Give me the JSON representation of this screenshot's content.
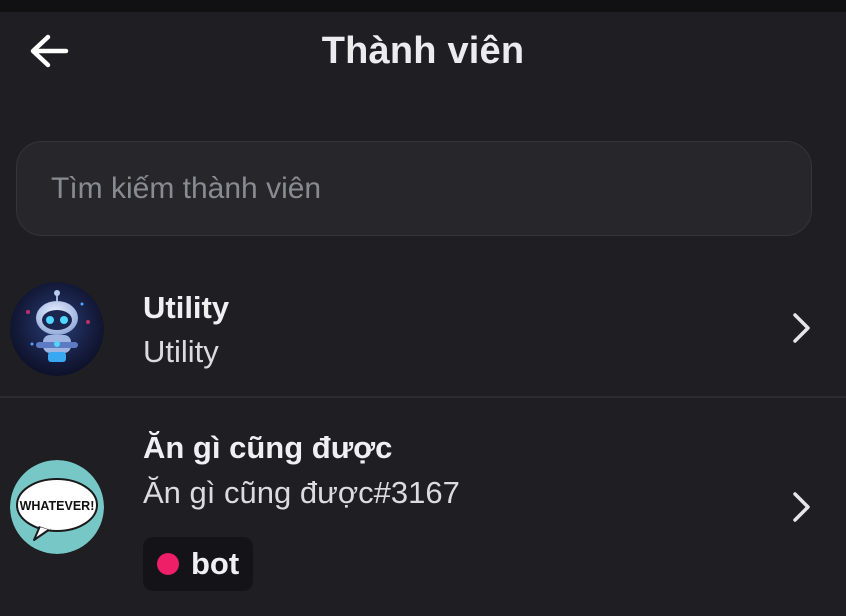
{
  "header": {
    "title": "Thành viên"
  },
  "search": {
    "placeholder": "Tìm kiếm thành viên",
    "value": ""
  },
  "members": [
    {
      "name": "Utility",
      "username": "Utility",
      "avatar_icon": "robot-avatar-icon"
    },
    {
      "name": "Ăn gì cũng được",
      "username": "Ăn gì cũng được#3167",
      "avatar_icon": "whatever-speech-bubble-avatar",
      "avatar_text": "WHATEVER!",
      "badge": {
        "label": "bot",
        "color": "#ee1f66"
      }
    }
  ],
  "colors": {
    "background": "#1e1e23",
    "search_background": "#26262b",
    "badge_background": "#141418",
    "bot_dot": "#ee1f66",
    "whatever_avatar_bg": "#76c7c5"
  }
}
